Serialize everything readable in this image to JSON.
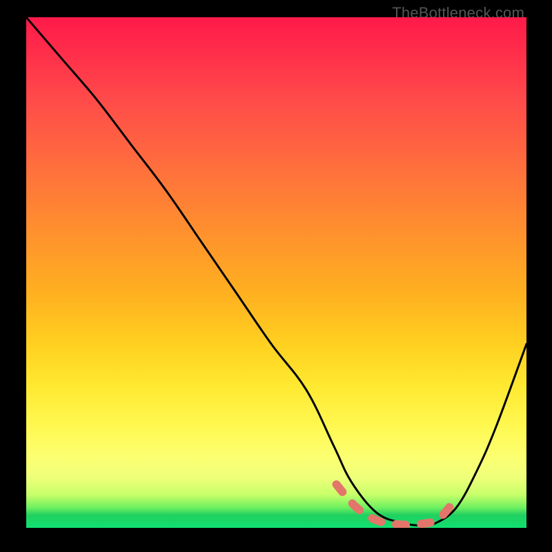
{
  "watermark": "TheBottleneck.com",
  "chart_data": {
    "type": "line",
    "title": "",
    "xlabel": "",
    "ylabel": "",
    "xlim": [
      0,
      100
    ],
    "ylim": [
      0,
      100
    ],
    "series": [
      {
        "name": "bottleneck-curve",
        "x": [
          0,
          7,
          14,
          21,
          28,
          35,
          42,
          49,
          56,
          61.5,
          65,
          70,
          75,
          79,
          82,
          86,
          90,
          94,
          100
        ],
        "values": [
          100,
          92,
          84,
          75,
          66,
          56,
          46,
          36,
          27,
          16,
          9,
          3,
          1,
          0.5,
          1,
          4,
          11,
          20,
          36
        ]
      },
      {
        "name": "highlight-range",
        "x": [
          62,
          66,
          70,
          74,
          78,
          82,
          85
        ],
        "values": [
          8.5,
          4,
          1.5,
          0.7,
          0.7,
          1.5,
          4.5
        ]
      }
    ],
    "colors": {
      "curve": "#000000",
      "highlight": "#e2766a"
    }
  }
}
